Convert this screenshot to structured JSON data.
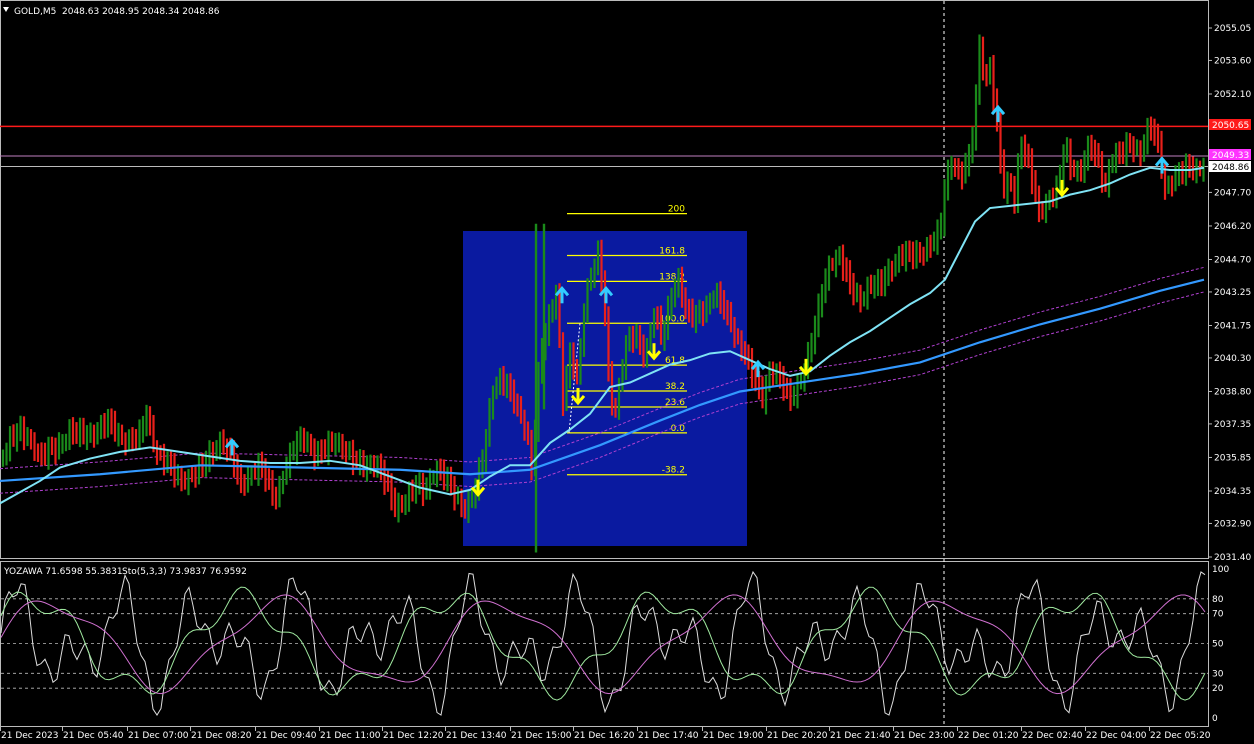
{
  "symbol_line": {
    "menu_icon": "triangle-down-icon",
    "symbol": "GOLD,M5",
    "ohlc": "2048.63 2048.95 2048.34 2048.86"
  },
  "indicator_line": {
    "yozawa": "YOZAWA 71.6598 55.3831",
    "stoch": "Sto(5,3,3) 73.9837 76.9592"
  },
  "price_scale": [
    "2055.05",
    "2053.60",
    "2052.10",
    "2050.65",
    "2049.33",
    "2048.86",
    "2047.70",
    "2046.20",
    "2044.70",
    "2043.25",
    "2041.75",
    "2040.30",
    "2038.80",
    "2037.35",
    "2035.85",
    "2034.35",
    "2032.90",
    "2031.40"
  ],
  "price_tags": {
    "red_line": "2050.65",
    "violet_line": "2049.33",
    "bid_line": "2048.86"
  },
  "osc_scale": [
    "100",
    "80",
    "70",
    "50",
    "30",
    "20",
    "0"
  ],
  "time_labels": [
    "21 Dec 2023",
    "21 Dec 05:40",
    "21 Dec 07:00",
    "21 Dec 08:20",
    "21 Dec 09:40",
    "21 Dec 11:00",
    "21 Dec 12:20",
    "21 Dec 13:40",
    "21 Dec 15:00",
    "21 Dec 16:20",
    "21 Dec 17:40",
    "21 Dec 19:00",
    "21 Dec 20:20",
    "21 Dec 21:40",
    "21 Dec 23:00",
    "22 Dec 01:20",
    "22 Dec 02:40",
    "22 Dec 04:00",
    "22 Dec 05:20"
  ],
  "fibonacci": {
    "levels": [
      "200",
      "161.8",
      "138.2",
      "100.0",
      "61.8",
      "38.2",
      "23.6",
      "0.0",
      "-38.2"
    ]
  },
  "colors": {
    "background": "#000000",
    "bull_bar": "#1a8a1a",
    "bear_bar": "#e8201a",
    "fast_ma": "#7fe3f5",
    "slow_ma": "#3399ff",
    "envelope": "#b040d0",
    "fib_box": "#0a1aa0",
    "fib_lines": "#ffff00",
    "resistance_line": "#ff1a1a",
    "violet_line": "#c080c0",
    "sell_arrow": "#33ccff",
    "buy_arrow": "#ffff00"
  },
  "chart_data": [
    {
      "type": "candlestick",
      "title": "GOLD,M5",
      "ylim": [
        2031.4,
        2055.6
      ],
      "x_range": [
        "21 Dec 2023",
        "22 Dec 05:40"
      ],
      "grid": false,
      "horizontal_lines": [
        2050.65,
        2049.33,
        2048.86
      ],
      "series": [
        {
          "name": "bars",
          "close_path": [
            [
              0,
              2035.9
            ],
            [
              10,
              2036.9
            ],
            [
              20,
              2037.1
            ],
            [
              30,
              2036.5
            ],
            [
              40,
              2035.6
            ],
            [
              55,
              2036.2
            ],
            [
              60,
              2036.5
            ],
            [
              70,
              2037.3
            ],
            [
              80,
              2037.1
            ],
            [
              90,
              2036.8
            ],
            [
              100,
              2037.0
            ],
            [
              110,
              2037.2
            ],
            [
              120,
              2036.6
            ],
            [
              130,
              2036.8
            ],
            [
              140,
              2037.1
            ],
            [
              147,
              2038.0
            ],
            [
              155,
              2036.2
            ],
            [
              160,
              2035.8
            ],
            [
              170,
              2035.2
            ],
            [
              180,
              2034.6
            ],
            [
              190,
              2035.0
            ],
            [
              200,
              2035.6
            ],
            [
              210,
              2036.2
            ],
            [
              220,
              2036.6
            ],
            [
              228,
              2036.0
            ],
            [
              234,
              2035.4
            ],
            [
              240,
              2034.3
            ],
            [
              250,
              2035.0
            ],
            [
              260,
              2035.6
            ],
            [
              268,
              2035.0
            ],
            [
              275,
              2034.2
            ],
            [
              285,
              2035.4
            ],
            [
              295,
              2036.2
            ],
            [
              305,
              2036.5
            ],
            [
              315,
              2035.8
            ],
            [
              325,
              2036.3
            ],
            [
              335,
              2036.9
            ],
            [
              345,
              2036.4
            ],
            [
              355,
              2035.6
            ],
            [
              365,
              2035.2
            ],
            [
              375,
              2035.4
            ],
            [
              385,
              2034.8
            ],
            [
              395,
              2033.8
            ],
            [
              405,
              2034.2
            ],
            [
              415,
              2034.7
            ],
            [
              425,
              2034.2
            ],
            [
              435,
              2035.1
            ],
            [
              445,
              2034.8
            ],
            [
              455,
              2034.2
            ],
            [
              465,
              2033.8
            ],
            [
              475,
              2034.6
            ],
            [
              485,
              2036.3
            ],
            [
              492,
              2038.7
            ],
            [
              500,
              2039.1
            ],
            [
              510,
              2038.6
            ],
            [
              518,
              2038.0
            ],
            [
              526,
              2037.3
            ],
            [
              532,
              2035.5
            ],
            [
              540,
              2040.6
            ],
            [
              550,
              2042.3
            ],
            [
              556,
              2043.2
            ],
            [
              563,
              2038.2
            ],
            [
              570,
              2040.1
            ],
            [
              578,
              2039.2
            ],
            [
              585,
              2043.1
            ],
            [
              592,
              2044.3
            ],
            [
              598,
              2045.1
            ],
            [
              604,
              2043.2
            ],
            [
              610,
              2038.6
            ],
            [
              616,
              2038.1
            ],
            [
              625,
              2040.6
            ],
            [
              635,
              2041.1
            ],
            [
              645,
              2040.2
            ],
            [
              655,
              2042.6
            ],
            [
              662,
              2041.2
            ],
            [
              670,
              2043.1
            ],
            [
              678,
              2044.1
            ],
            [
              686,
              2042.3
            ],
            [
              695,
              2041.8
            ],
            [
              705,
              2042.3
            ],
            [
              715,
              2043.2
            ],
            [
              725,
              2042.6
            ],
            [
              735,
              2041.6
            ],
            [
              745,
              2040.6
            ],
            [
              755,
              2039.1
            ],
            [
              763,
              2038.2
            ],
            [
              770,
              2039.6
            ],
            [
              780,
              2039.3
            ],
            [
              790,
              2038.6
            ],
            [
              798,
              2039.3
            ],
            [
              805,
              2040.1
            ],
            [
              815,
              2041.7
            ],
            [
              822,
              2043.1
            ],
            [
              830,
              2044.3
            ],
            [
              840,
              2044.6
            ],
            [
              850,
              2043.6
            ],
            [
              860,
              2043.1
            ],
            [
              870,
              2043.8
            ],
            [
              880,
              2043.6
            ],
            [
              890,
              2044.1
            ],
            [
              900,
              2044.6
            ],
            [
              910,
              2044.8
            ],
            [
              920,
              2045.1
            ],
            [
              930,
              2045.6
            ],
            [
              940,
              2046.1
            ],
            [
              945,
              2048.1
            ],
            [
              952,
              2049.1
            ],
            [
              960,
              2048.1
            ],
            [
              970,
              2049.1
            ],
            [
              975,
              2051.1
            ],
            [
              980,
              2054.6
            ],
            [
              985,
              2052.6
            ],
            [
              990,
              2053.6
            ],
            [
              995,
              2051.6
            ],
            [
              1000,
              2049.6
            ],
            [
              1005,
              2047.6
            ],
            [
              1010,
              2048.6
            ],
            [
              1015,
              2047.1
            ],
            [
              1020,
              2050.1
            ],
            [
              1025,
              2049.1
            ],
            [
              1030,
              2048.6
            ],
            [
              1038,
              2046.6
            ],
            [
              1045,
              2047.1
            ],
            [
              1050,
              2047.6
            ],
            [
              1058,
              2048.1
            ],
            [
              1065,
              2050.1
            ],
            [
              1070,
              2049.1
            ],
            [
              1080,
              2048.6
            ],
            [
              1090,
              2049.6
            ],
            [
              1100,
              2048.6
            ],
            [
              1105,
              2047.6
            ],
            [
              1110,
              2049.1
            ],
            [
              1120,
              2049.6
            ],
            [
              1130,
              2050.1
            ],
            [
              1140,
              2049.6
            ],
            [
              1150,
              2050.6
            ],
            [
              1158,
              2049.6
            ],
            [
              1165,
              2047.6
            ],
            [
              1172,
              2048.1
            ],
            [
              1180,
              2048.6
            ],
            [
              1190,
              2049.1
            ],
            [
              1197,
              2048.9
            ],
            [
              1204,
              2049.2
            ]
          ]
        },
        {
          "name": "fast MA",
          "values": [
            [
              0,
              2033.8
            ],
            [
              20,
              2034.3
            ],
            [
              40,
              2034.8
            ],
            [
              60,
              2035.4
            ],
            [
              90,
              2035.8
            ],
            [
              120,
              2036.1
            ],
            [
              150,
              2036.3
            ],
            [
              180,
              2036.1
            ],
            [
              210,
              2035.9
            ],
            [
              240,
              2035.7
            ],
            [
              270,
              2035.6
            ],
            [
              300,
              2035.6
            ],
            [
              330,
              2035.7
            ],
            [
              360,
              2035.5
            ],
            [
              390,
              2035.0
            ],
            [
              420,
              2034.5
            ],
            [
              450,
              2034.2
            ],
            [
              470,
              2034.4
            ],
            [
              490,
              2035.0
            ],
            [
              510,
              2035.5
            ],
            [
              530,
              2035.5
            ],
            [
              550,
              2036.5
            ],
            [
              570,
              2037.1
            ],
            [
              590,
              2037.8
            ],
            [
              610,
              2039.0
            ],
            [
              630,
              2039.2
            ],
            [
              650,
              2039.6
            ],
            [
              670,
              2040.0
            ],
            [
              690,
              2040.2
            ],
            [
              710,
              2040.5
            ],
            [
              730,
              2040.6
            ],
            [
              750,
              2040.2
            ],
            [
              770,
              2039.8
            ],
            [
              790,
              2039.5
            ],
            [
              810,
              2039.7
            ],
            [
              830,
              2040.4
            ],
            [
              850,
              2041.0
            ],
            [
              870,
              2041.5
            ],
            [
              890,
              2042.1
            ],
            [
              910,
              2042.7
            ],
            [
              930,
              2043.2
            ],
            [
              945,
              2043.8
            ],
            [
              960,
              2045.1
            ],
            [
              975,
              2046.4
            ],
            [
              990,
              2047.0
            ],
            [
              1010,
              2047.1
            ],
            [
              1030,
              2047.2
            ],
            [
              1050,
              2047.3
            ],
            [
              1070,
              2047.6
            ],
            [
              1090,
              2047.8
            ],
            [
              1110,
              2048.1
            ],
            [
              1130,
              2048.5
            ],
            [
              1150,
              2048.8
            ],
            [
              1170,
              2048.7
            ],
            [
              1190,
              2048.7
            ],
            [
              1204,
              2048.8
            ]
          ]
        },
        {
          "name": "slow MA",
          "values": [
            [
              0,
              2034.8
            ],
            [
              100,
              2035.1
            ],
            [
              200,
              2035.5
            ],
            [
              300,
              2035.4
            ],
            [
              400,
              2035.3
            ],
            [
              470,
              2035.1
            ],
            [
              530,
              2035.3
            ],
            [
              600,
              2036.4
            ],
            [
              660,
              2037.5
            ],
            [
              700,
              2038.2
            ],
            [
              740,
              2038.8
            ],
            [
              800,
              2039.2
            ],
            [
              860,
              2039.6
            ],
            [
              920,
              2040.1
            ],
            [
              980,
              2041.0
            ],
            [
              1040,
              2041.8
            ],
            [
              1100,
              2042.5
            ],
            [
              1160,
              2043.3
            ],
            [
              1204,
              2043.8
            ]
          ]
        }
      ]
    },
    {
      "type": "line",
      "title": "YOZAWA / Sto(5,3,3)",
      "ylim": [
        0,
        100
      ],
      "levels": [
        80,
        70,
        50,
        30,
        20
      ],
      "series": [
        {
          "name": "Sto(5,3,3)",
          "values": [
            73.9837,
            76.9592
          ]
        },
        {
          "name": "YOZAWA",
          "values": [
            71.6598,
            55.3831
          ]
        }
      ]
    }
  ]
}
